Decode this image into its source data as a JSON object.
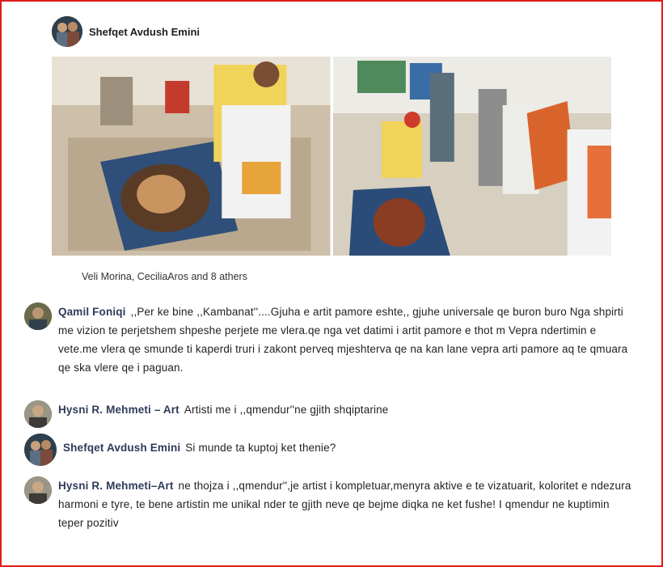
{
  "post": {
    "author": "Shefqet Avdush Emini",
    "reactions_text": "Veli Morina, CeciliaAros and 8 athers"
  },
  "comments": [
    {
      "author": "Qamil Foniqi",
      "text": ",,Per ke bine ,,Kambanat''....Gjuha e artit pamore eshte,, gjuhe universale qe buron buro Nga shpirti me vizion te perjetshem shpeshe perjete me vlera.qe nga vet datimi i artit pamore e thot m Vepra ndertimin e vete.me vlera qe smunde ti kaperdi truri i zakont perveq mjeshterva qe na kan lane vepra arti pamore aq te qmuara qe ska vlere qe i paguan."
    },
    {
      "author": "Hysni R. Mehmeti – Art",
      "text": "Artisti me i ,,qmendur''ne gjith shqiptarine"
    },
    {
      "author": "Shefqet Avdush Emini",
      "text": "Si munde ta kuptoj ket thenie?"
    },
    {
      "author": "Hysni R. Mehmeti–Art",
      "text": "ne thojza i ,,qmendur'',je artist i kompletuar,menyra aktive e te vizatuarit, koloritet e ndezura harmoni e tyre, te bene artistin me unikal nder te gjith neve qe bejme diqka ne ket fushe! I qmendur ne kuptimin teper pozitiv"
    }
  ],
  "colors": {
    "frame_border": "#e01b1b",
    "commenter_name": "#2e3b59"
  }
}
